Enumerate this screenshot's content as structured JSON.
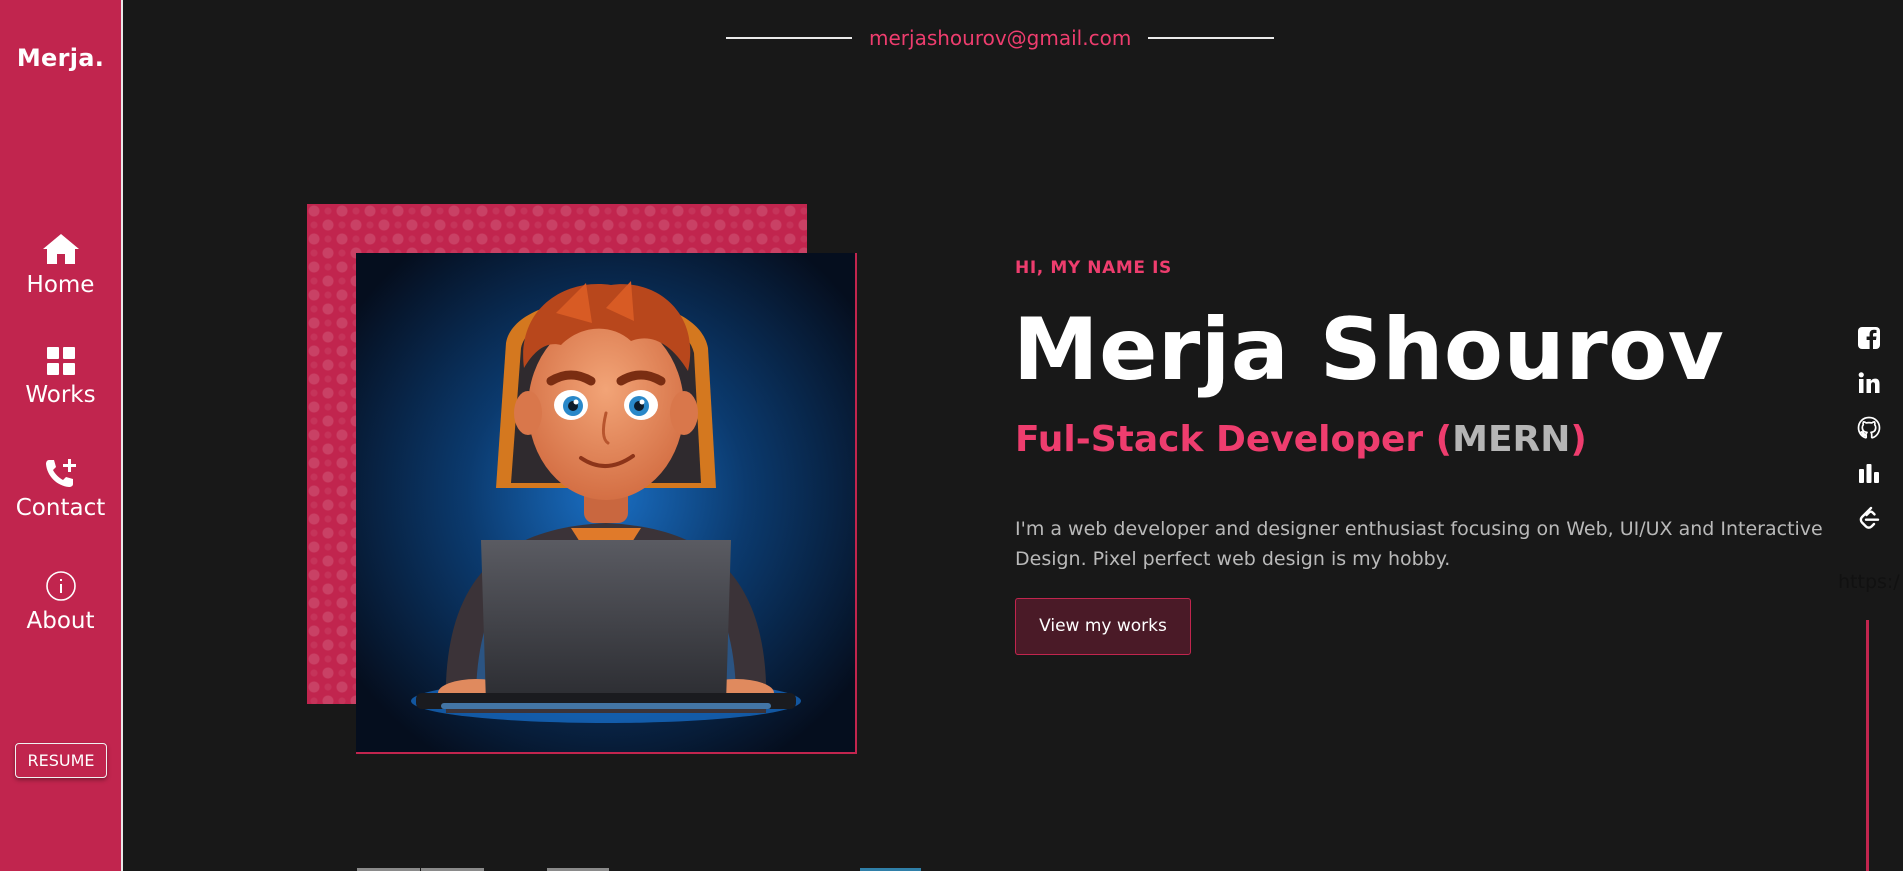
{
  "sidebar": {
    "brand": "Merja.",
    "items": [
      {
        "label": "Home",
        "icon": "home-icon"
      },
      {
        "label": "Works",
        "icon": "grid-icon"
      },
      {
        "label": "Contact",
        "icon": "phone-add-icon"
      },
      {
        "label": "About",
        "icon": "info-icon"
      }
    ],
    "resume_label": "RESUME"
  },
  "header": {
    "email": "merjashourov@gmail.com"
  },
  "hero": {
    "greeting": "HI, MY NAME IS",
    "name": "Merja Shourov",
    "role_prefix": "Ful-Stack Developer (",
    "role_stack": "MERN",
    "role_suffix": ")",
    "bio": "I'm a web developer and designer enthusiast focusing on Web, UI/UX and Interactive Design. Pixel perfect web design is my hobby.",
    "cta_label": "View my works",
    "portrait_icon": "developer-avatar-illustration"
  },
  "social": {
    "icons": [
      "facebook-icon",
      "linkedin-icon",
      "github-icon",
      "stats-icon",
      "leetcode-icon"
    ],
    "url_text": "https:/"
  },
  "colors": {
    "accent": "#c1254e",
    "accent_text": "#ee3d6e",
    "background": "#181818",
    "muted_text": "#b9b9b9"
  }
}
